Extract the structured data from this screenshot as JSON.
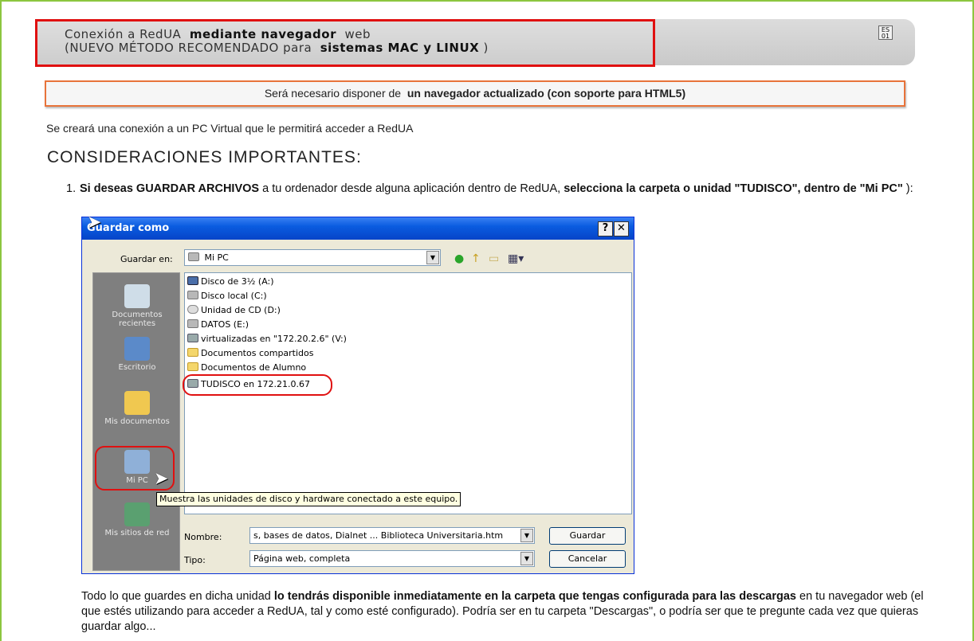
{
  "header": {
    "line1_a": "Conexión a RedUA",
    "line1_b": "mediante navegador",
    "line1_c": "web",
    "line2_a": "(NUEVO MÉTODO RECOMENDADO para",
    "line2_b": "sistemas MAC y LINUX",
    "line2_c": ")",
    "lang_icon_label": "ES\n01",
    "highlight_color": "#e01010"
  },
  "notice": {
    "prefix": "Será necesario disponer de",
    "bold": "un navegador actualizado (con soporte para HTML5)"
  },
  "intro": "Se creará una conexión a un PC Virtual que le permitirá acceder a RedUA",
  "heading": "CONSIDERACIONES IMPORTANTES:",
  "item1": {
    "number": "1.",
    "bold_a": "Si deseas GUARDAR ARCHIVOS",
    "text_b": "a tu ordenador desde alguna aplicación dentro de RedUA,",
    "bold_c": "selecciona la carpeta o unidad \"TUDISCO\", dentro de \"Mi PC\"",
    "text_d": "):"
  },
  "dialog": {
    "title": "Guardar como",
    "help": "?",
    "close": "✕",
    "save_in_label": "Guardar en:",
    "save_in_value": "Mi PC",
    "places": [
      {
        "label": "Documentos recientes",
        "icon": "recent-documents-icon"
      },
      {
        "label": "Escritorio",
        "icon": "desktop-icon"
      },
      {
        "label": "Mis documentos",
        "icon": "my-documents-icon"
      },
      {
        "label": "Mi PC",
        "icon": "my-computer-icon"
      },
      {
        "label": "Mis sitios de red",
        "icon": "network-places-icon"
      }
    ],
    "files": [
      {
        "name": "Disco de 3½ (A:)",
        "kind": "floppy"
      },
      {
        "name": "Disco local (C:)",
        "kind": "drive"
      },
      {
        "name": "Unidad de CD (D:)",
        "kind": "cd"
      },
      {
        "name": "DATOS (E:)",
        "kind": "drive"
      },
      {
        "name": "virtualizadas en \"172.20.2.6\" (V:)",
        "kind": "net"
      },
      {
        "name": "Documentos compartidos",
        "kind": "folder"
      },
      {
        "name": "Documentos de Alumno",
        "kind": "folder"
      },
      {
        "name": "TUDISCO en 172.21.0.67",
        "kind": "net"
      }
    ],
    "tooltip": "Muestra las unidades de disco y hardware conectado a este equipo.",
    "name_label": "Nombre:",
    "name_value": "s, bases de datos, Dialnet ... Biblioteca Universitaria.htm",
    "type_label": "Tipo:",
    "type_value": "Página web, completa",
    "save_button": "Guardar",
    "cancel_button": "Cancelar"
  },
  "bottom": {
    "text_a": "Todo lo que guardes en dicha unidad",
    "bold_b": "lo tendrás disponible inmediatamente en la carpeta que tengas configurada para las descargas",
    "text_c": "en tu navegador web (el que estés utilizando para acceder a RedUA, tal y como esté configurado). Podría ser en tu carpeta \"Descargas\", o podría ser que te pregunte cada vez que quieras guardar algo..."
  }
}
